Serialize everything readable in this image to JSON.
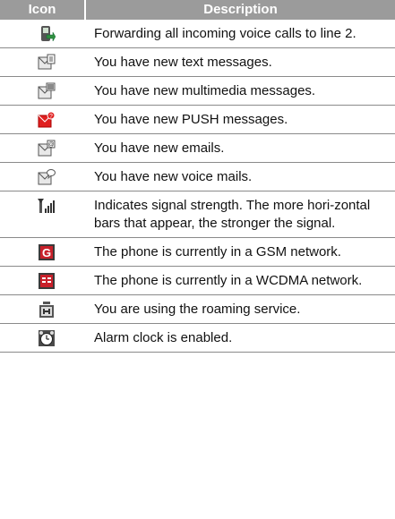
{
  "table": {
    "header": {
      "icon": "Icon",
      "description": "Description"
    },
    "rows": [
      {
        "icon": "call-forward-icon",
        "description": "Forwarding all incoming voice calls to line 2."
      },
      {
        "icon": "text-message-icon",
        "description": "You have new text messages."
      },
      {
        "icon": "multimedia-message-icon",
        "description": "You have new multimedia messages."
      },
      {
        "icon": "push-message-icon",
        "description": "You have new PUSH messages."
      },
      {
        "icon": "email-icon",
        "description": "You have new emails."
      },
      {
        "icon": "voice-mail-icon",
        "description": "You have new voice mails."
      },
      {
        "icon": "signal-strength-icon",
        "description": "Indicates signal strength. The more hori-zontal bars that appear, the stronger the signal."
      },
      {
        "icon": "gsm-network-icon",
        "description": "The phone is currently in a GSM network."
      },
      {
        "icon": "wcdma-network-icon",
        "description": "The phone is currently in a WCDMA network."
      },
      {
        "icon": "roaming-icon",
        "description": "You are using the roaming service."
      },
      {
        "icon": "alarm-clock-icon",
        "description": "Alarm clock is enabled."
      }
    ]
  },
  "colors": {
    "header_bg": "#9b9b9b",
    "push_red": "#e02020",
    "network_red": "#c8202a"
  }
}
